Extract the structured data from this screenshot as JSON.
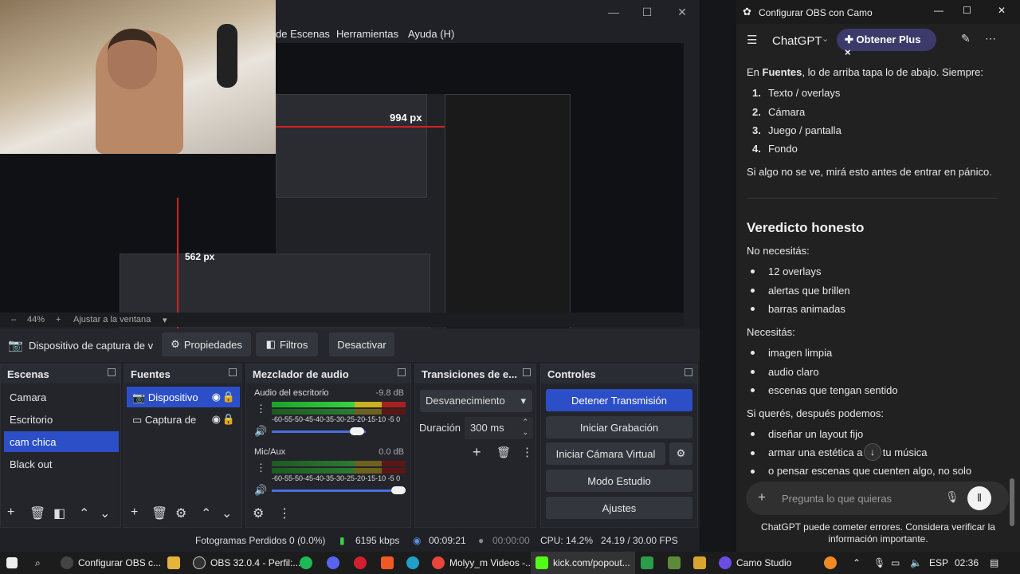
{
  "obs": {
    "menu": [
      "de Escenas",
      "Herramientas",
      "Ayuda (H)"
    ],
    "preview_label_1": "994 px",
    "preview_label_2": "562 px",
    "zoom": "44%",
    "fit_label": "Ajustar a la ventana",
    "source_name": "Dispositivo de captura de v",
    "properties_label": "Propiedades",
    "filters_label": "Filtros",
    "deactivate_label": "Desactivar",
    "docks": {
      "scenes": "Escenas",
      "sources": "Fuentes",
      "mixer": "Mezclador de audio",
      "transitions": "Transiciones de e...",
      "controls": "Controles"
    },
    "scenes": [
      "Camara",
      "Escritorio",
      "cam chica",
      "Black out"
    ],
    "sources": [
      "Dispositivo",
      "Captura de"
    ],
    "audio": [
      {
        "name": "Audio del escritorio",
        "db": "-9.8 dB"
      },
      {
        "name": "Mic/Aux",
        "db": "0.0 dB"
      }
    ],
    "meter_ticks": "-60-55-50-45-40-35-30-25-20-15-10 -5  0",
    "transition": "Desvanecimiento",
    "duration_label": "Duración",
    "duration_value": "300 ms",
    "controls": [
      "Detener Transmisión",
      "Iniciar Grabación",
      "Iniciar Cámara Virtual",
      "Modo Estudio",
      "Ajustes"
    ],
    "status": {
      "dropped": "Fotogramas Perdidos 0 (0.0%)",
      "kbps": "6195 kbps",
      "live_time": "00:09:21",
      "rec_time": "00:00:00",
      "cpu": "CPU: 14.2%",
      "fps": "24.19 / 30.00 FPS"
    }
  },
  "chatgpt": {
    "window_title": "Configurar OBS con Camo",
    "app_name": "ChatGPT",
    "plus_label": "Obtener Plus",
    "fuentes_intro_bold": "Fuentes",
    "fuentes_intro_rest": ", lo de arriba tapa lo de abajo. Siempre:",
    "fuentes_intro_prefix": "En ",
    "order": [
      "Texto / overlays",
      "Cámara",
      "Juego / pantalla",
      "Fondo"
    ],
    "panic_line": "Si algo no se ve, mirá esto antes de entrar en pánico.",
    "verdict_heading": "Veredicto honesto",
    "no_need_label": "No necesitás:",
    "no_need": [
      "12 overlays",
      "alertas que brillen",
      "barras animadas"
    ],
    "need_label": "Necesitás:",
    "need": [
      "imagen limpia",
      "audio claro",
      "escenas que tengan sentido"
    ],
    "later_label": "Si querés, después podemos:",
    "later": [
      "diseñar un layout fijo",
      "armar una estética a    e a tu música",
      "o pensar escenas que cuenten algo, no solo"
    ],
    "input_placeholder": "Pregunta lo que quieras",
    "disclaimer": "ChatGPT puede cometer errores. Considera verificar la información importante."
  },
  "taskbar": {
    "items": [
      "Configurar OBS c...",
      "OBS 32.0.4 - Perfil:...",
      "Molyy_m Videos -...",
      "kick.com/popout...",
      "Camo Studio"
    ],
    "lang": "ESP",
    "time": "02:36"
  }
}
